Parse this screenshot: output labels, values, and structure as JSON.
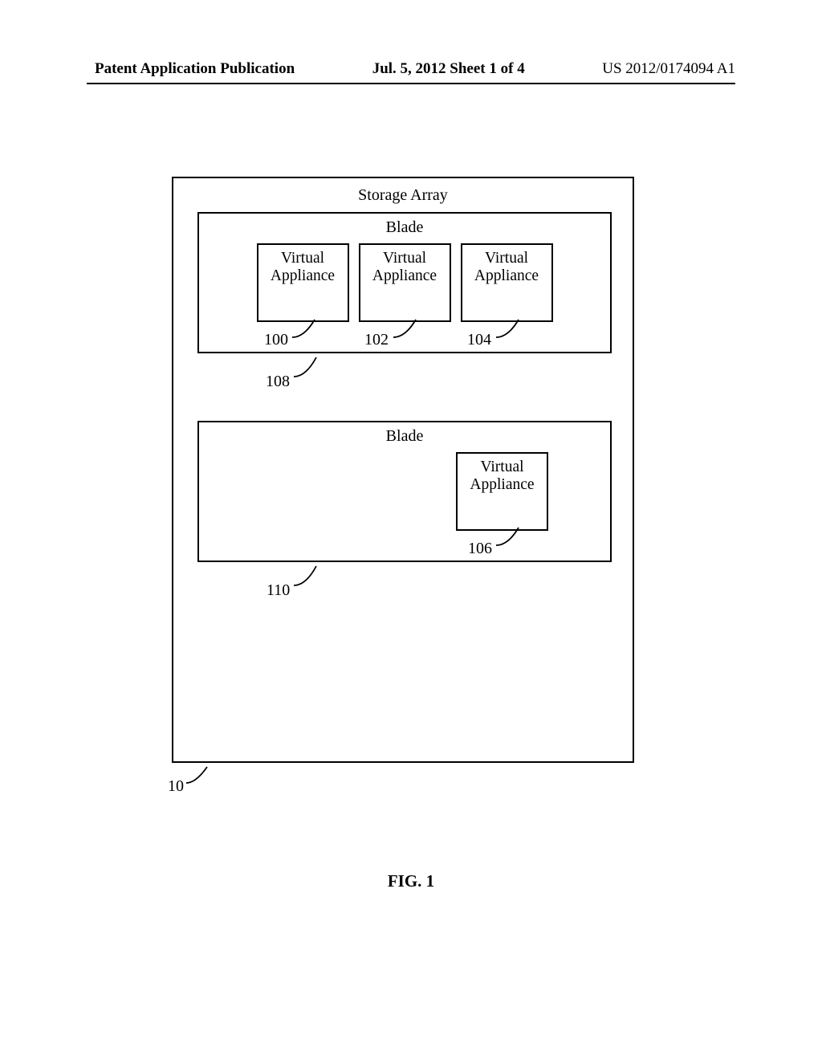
{
  "header": {
    "left": "Patent Application Publication",
    "center": "Jul. 5, 2012   Sheet 1 of 4",
    "right": "US 2012/0174094 A1"
  },
  "diagram": {
    "storage_array_title": "Storage Array",
    "blade1": {
      "title": "Blade",
      "va": [
        "Virtual\nAppliance",
        "Virtual\nAppliance",
        "Virtual\nAppliance"
      ],
      "va_refs": [
        "100",
        "102",
        "104"
      ],
      "ref": "108"
    },
    "blade2": {
      "title": "Blade",
      "va": [
        "Virtual\nAppliance"
      ],
      "va_refs": [
        "106"
      ],
      "ref": "110"
    },
    "array_ref": "10",
    "figure_label": "FIG. 1"
  }
}
